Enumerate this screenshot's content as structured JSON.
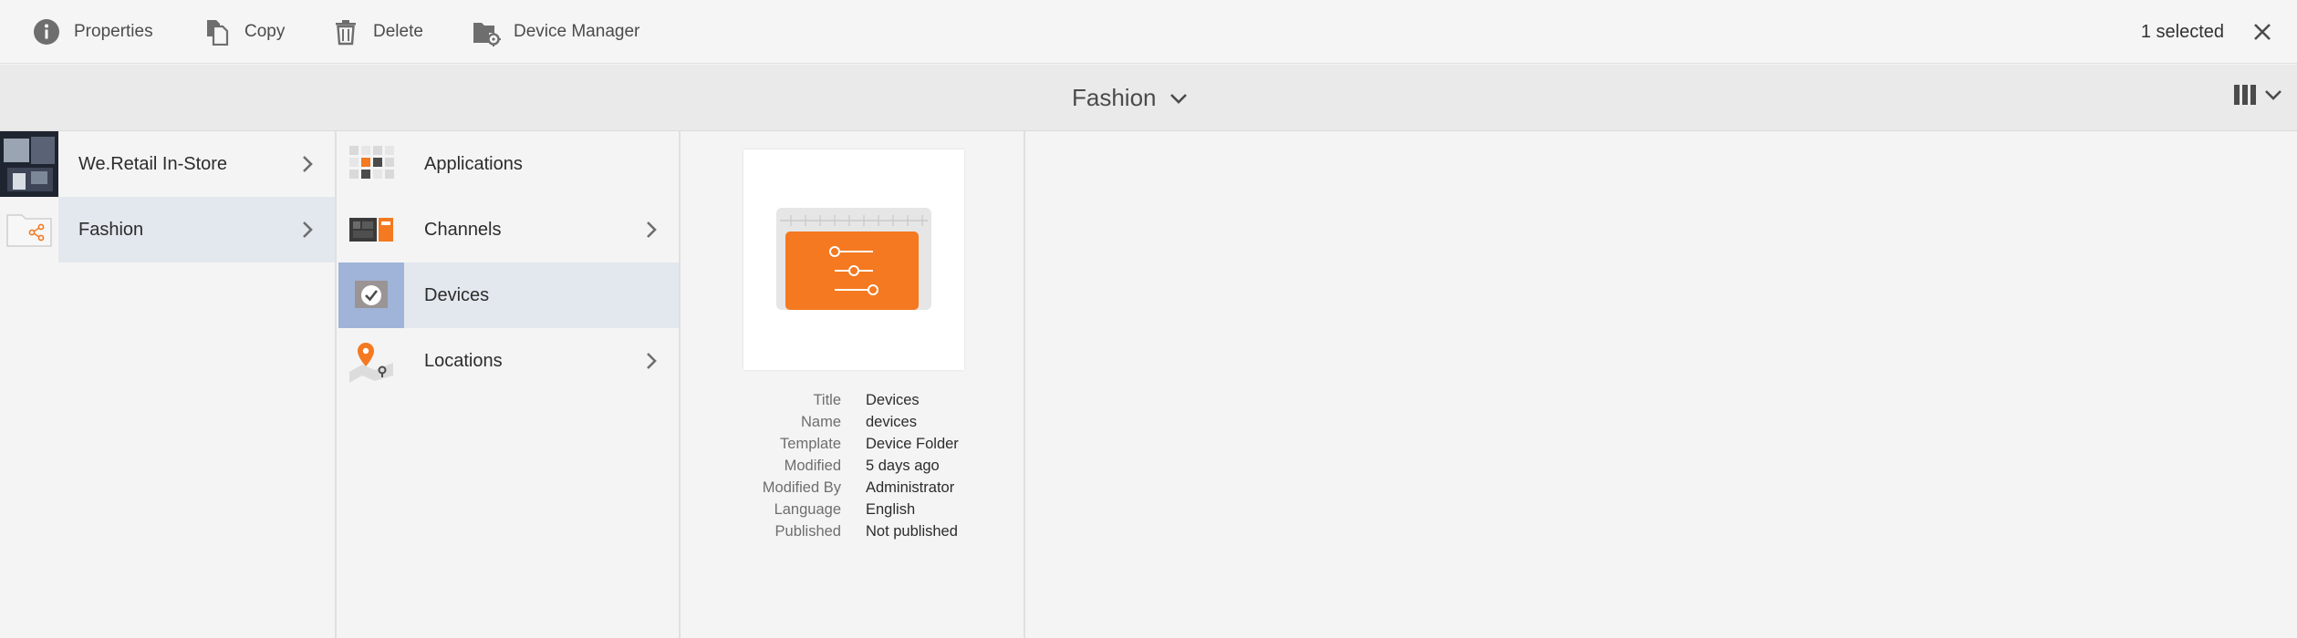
{
  "actionbar": {
    "properties_label": "Properties",
    "copy_label": "Copy",
    "delete_label": "Delete",
    "device_manager_label": "Device Manager",
    "selected_text": "1 selected"
  },
  "titlebar": {
    "title": "Fashion"
  },
  "columns": {
    "col1": [
      {
        "label": "We.Retail In-Store",
        "has_children": true,
        "active": false
      },
      {
        "label": "Fashion",
        "has_children": true,
        "active": true
      }
    ],
    "col2": [
      {
        "label": "Applications",
        "has_children": false,
        "active": false
      },
      {
        "label": "Channels",
        "has_children": true,
        "active": false
      },
      {
        "label": "Devices",
        "has_children": false,
        "active": true
      },
      {
        "label": "Locations",
        "has_children": true,
        "active": false
      }
    ]
  },
  "details": {
    "rows": [
      {
        "key": "Title",
        "value": "Devices"
      },
      {
        "key": "Name",
        "value": "devices"
      },
      {
        "key": "Template",
        "value": "Device Folder"
      },
      {
        "key": "Modified",
        "value": "5 days ago"
      },
      {
        "key": "Modified By",
        "value": "Administrator"
      },
      {
        "key": "Language",
        "value": "English"
      },
      {
        "key": "Published",
        "value": "Not published"
      }
    ]
  },
  "colors": {
    "accent": "#f47920",
    "active_row": "#e3e7ee",
    "selected_thumb": "#9fb4d8"
  }
}
